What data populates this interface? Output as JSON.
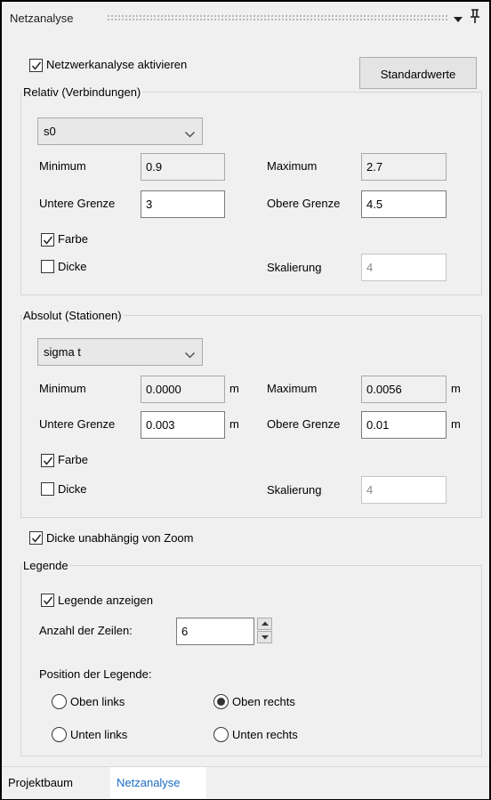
{
  "panel": {
    "title": "Netzanalyse",
    "pin_icon": "pin-icon",
    "menu_icon": "dropdown-triangle-icon"
  },
  "top": {
    "enable_label": "Netzwerkanalyse aktivieren",
    "enable_checked": true,
    "defaults_button": "Standardwerte"
  },
  "relativ": {
    "title": "Relativ (Verbindungen)",
    "select_value": "s0",
    "minimum_label": "Minimum",
    "minimum_value": "0.9",
    "maximum_label": "Maximum",
    "maximum_value": "2.7",
    "lower_label": "Untere Grenze",
    "lower_value": "3",
    "upper_label": "Obere Grenze",
    "upper_value": "4.5",
    "farbe_label": "Farbe",
    "farbe_checked": true,
    "dicke_label": "Dicke",
    "dicke_checked": false,
    "scale_label": "Skalierung",
    "scale_value": "4"
  },
  "absolut": {
    "title": "Absolut (Stationen)",
    "select_value": "sigma t",
    "minimum_label": "Minimum",
    "minimum_value": "0.0000",
    "minimum_unit": "m",
    "maximum_label": "Maximum",
    "maximum_value": "0.0056",
    "maximum_unit": "m",
    "lower_label": "Untere Grenze",
    "lower_value": "0.003",
    "lower_unit": "m",
    "upper_label": "Obere Grenze",
    "upper_value": "0.01",
    "upper_unit": "m",
    "farbe_label": "Farbe",
    "farbe_checked": true,
    "dicke_label": "Dicke",
    "dicke_checked": false,
    "scale_label": "Skalierung",
    "scale_value": "4"
  },
  "zoom": {
    "label": "Dicke unabhängig von Zoom",
    "checked": true
  },
  "legend": {
    "title": "Legende",
    "show_label": "Legende anzeigen",
    "show_checked": true,
    "rows_label": "Anzahl der Zeilen:",
    "rows_value": "6",
    "position_label": "Position der Legende:",
    "positions": [
      {
        "label": "Oben links",
        "selected": false
      },
      {
        "label": "Oben rechts",
        "selected": true
      },
      {
        "label": "Unten links",
        "selected": false
      },
      {
        "label": "Unten rechts",
        "selected": false
      }
    ]
  },
  "tabs": [
    {
      "label": "Projektbaum",
      "active": false
    },
    {
      "label": "Netzanalyse",
      "active": true
    }
  ],
  "colors": {
    "active_tab_text": "#1a6dc2",
    "panel_bg": "#f0f0f0"
  }
}
